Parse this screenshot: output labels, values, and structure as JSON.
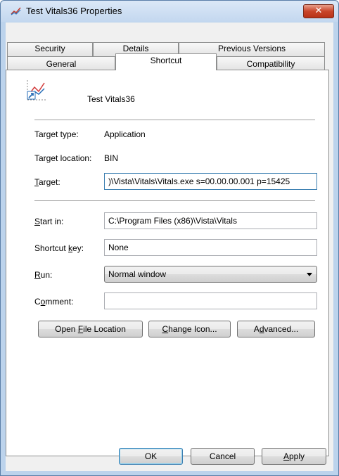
{
  "window": {
    "title": "Test Vitals36 Properties",
    "close_glyph": "✕"
  },
  "tabs": {
    "row_back": [
      "Security",
      "Details",
      "Previous Versions"
    ],
    "row_front": [
      "General",
      "Shortcut",
      "Compatibility"
    ],
    "selected": "Shortcut"
  },
  "shortcut": {
    "name": "Test Vitals36",
    "icon": "shortcut-chart-icon",
    "target_type_label": "Target type:",
    "target_type_value": "Application",
    "target_location_label": "Target location:",
    "target_location_value": "BIN",
    "target_label_pre": "",
    "target_label_accel": "T",
    "target_label_post": "arget:",
    "target_value": ")\\Vista\\Vitals\\Vitals.exe s=00.00.00.001 p=15425",
    "startin_label_accel": "S",
    "startin_label_post": "tart in:",
    "startin_value": "C:\\Program Files (x86)\\Vista\\Vitals",
    "shortcutkey_label_pre": "Shortcut ",
    "shortcutkey_label_accel": "k",
    "shortcutkey_label_post": "ey:",
    "shortcutkey_value": "None",
    "run_label_accel": "R",
    "run_label_post": "un:",
    "run_value": "Normal window",
    "comment_label_pre": "C",
    "comment_label_accel": "o",
    "comment_label_post": "mment:",
    "comment_value": ""
  },
  "buttons": {
    "open_pre": "Open ",
    "open_accel": "F",
    "open_post": "ile Location",
    "change_accel": "C",
    "change_post": "hange Icon...",
    "adv_pre": "A",
    "adv_accel": "d",
    "adv_post": "vanced..."
  },
  "footer": {
    "ok": "OK",
    "cancel": "Cancel",
    "apply_accel": "A",
    "apply_post": "pply"
  },
  "colors": {
    "accent": "#3c7fb1",
    "close": "#c9452a"
  }
}
